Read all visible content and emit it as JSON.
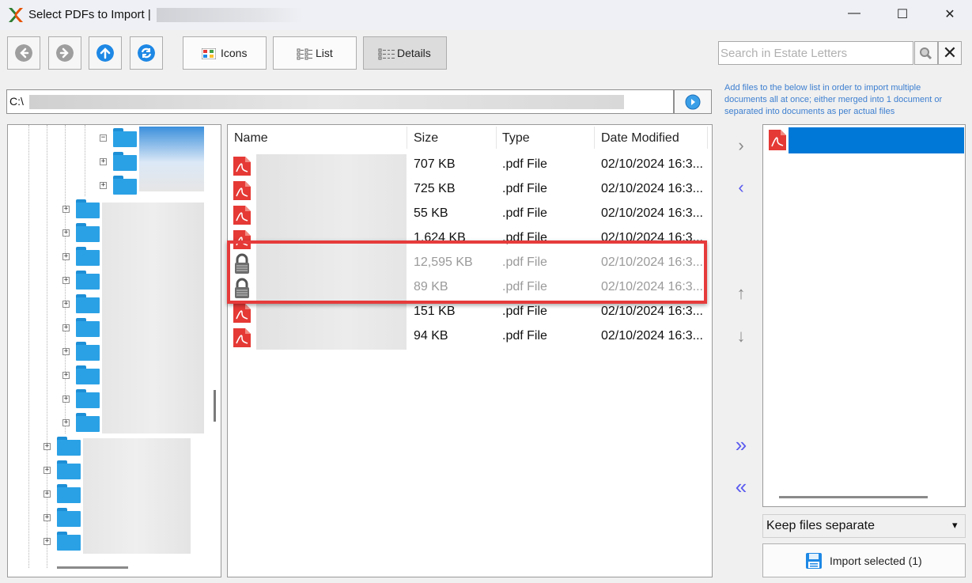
{
  "window": {
    "title": "Select PDFs to Import  |",
    "minimize_glyph": "—",
    "maximize_glyph": "☐",
    "close_glyph": "✕"
  },
  "toolbar": {
    "nav_icons": [
      "back-arrow-icon",
      "forward-arrow-icon",
      "up-arrow-icon",
      "refresh-icon"
    ],
    "view_buttons": [
      {
        "label": "Icons",
        "selected": false
      },
      {
        "label": "List",
        "selected": false
      },
      {
        "label": "Details",
        "selected": true
      }
    ]
  },
  "search": {
    "placeholder": "Search in Estate Letters",
    "clear_glyph": "✕"
  },
  "hint": "Add files to the below list in order to import multiple documents all at once; either merged into 1 document or separated into documents as per actual files",
  "path": {
    "value": "C:\\"
  },
  "file_list": {
    "columns": [
      "Name",
      "Size",
      "Type",
      "Date Modified"
    ],
    "rows": [
      {
        "icon": "pdf-icon",
        "size": "707 KB",
        "type": ".pdf File",
        "date": "02/10/2024 16:3...",
        "locked": false
      },
      {
        "icon": "pdf-icon",
        "size": "725 KB",
        "type": ".pdf File",
        "date": "02/10/2024 16:3...",
        "locked": false
      },
      {
        "icon": "pdf-icon",
        "size": "55 KB",
        "type": ".pdf File",
        "date": "02/10/2024 16:3...",
        "locked": false
      },
      {
        "icon": "pdf-icon",
        "size": "1,624 KB",
        "type": ".pdf File",
        "date": "02/10/2024 16:3...",
        "locked": false
      },
      {
        "icon": "lock-icon",
        "size": "12,595 KB",
        "type": ".pdf File",
        "date": "02/10/2024 16:3...",
        "locked": true
      },
      {
        "icon": "lock-icon",
        "size": "89 KB",
        "type": ".pdf File",
        "date": "02/10/2024 16:3...",
        "locked": true
      },
      {
        "icon": "pdf-icon",
        "size": "151 KB",
        "type": ".pdf File",
        "date": "02/10/2024 16:3...",
        "locked": false
      },
      {
        "icon": "pdf-icon",
        "size": "94 KB",
        "type": ".pdf File",
        "date": "02/10/2024 16:3...",
        "locked": false
      }
    ]
  },
  "transfer_buttons": {
    "add": "›",
    "remove": "‹",
    "move_up": "↑",
    "move_down": "↓",
    "add_all": "»",
    "remove_all": "«"
  },
  "import_mode": {
    "selected": "Keep files separate",
    "arrow": "▾"
  },
  "import_button": {
    "label": "Import selected (1)"
  },
  "colors": {
    "accent_blue": "#0078d7",
    "highlight_red": "#e63b3b",
    "folder_blue": "#2ba1e5",
    "pdf_red": "#e53935",
    "hint_blue": "#3d7fd0"
  }
}
